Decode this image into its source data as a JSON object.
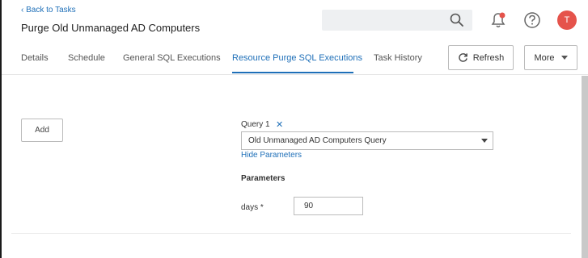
{
  "header": {
    "back_link": "Back to Tasks",
    "back_chevron": "‹",
    "title": "Purge Old Unmanaged AD Computers",
    "avatar_initial": "T",
    "notification_dot_color": "#e5534b"
  },
  "tabs": [
    {
      "label": "Details"
    },
    {
      "label": "Schedule"
    },
    {
      "label": "General SQL Executions"
    },
    {
      "label": "Resource Purge SQL Executions",
      "active": true
    },
    {
      "label": "Task History"
    }
  ],
  "toolbar": {
    "refresh_label": "Refresh",
    "more_label": "More"
  },
  "main": {
    "add_label": "Add",
    "query": {
      "label": "Query 1",
      "remove_glyph": "✕",
      "selected": "Old Unmanaged AD Computers Query",
      "hide_params_label": "Hide Parameters"
    },
    "parameters": {
      "heading": "Parameters",
      "days_label": "days *",
      "days_value": "90"
    }
  },
  "colors": {
    "accent": "#1e6fb8",
    "avatar": "#e5534b"
  }
}
